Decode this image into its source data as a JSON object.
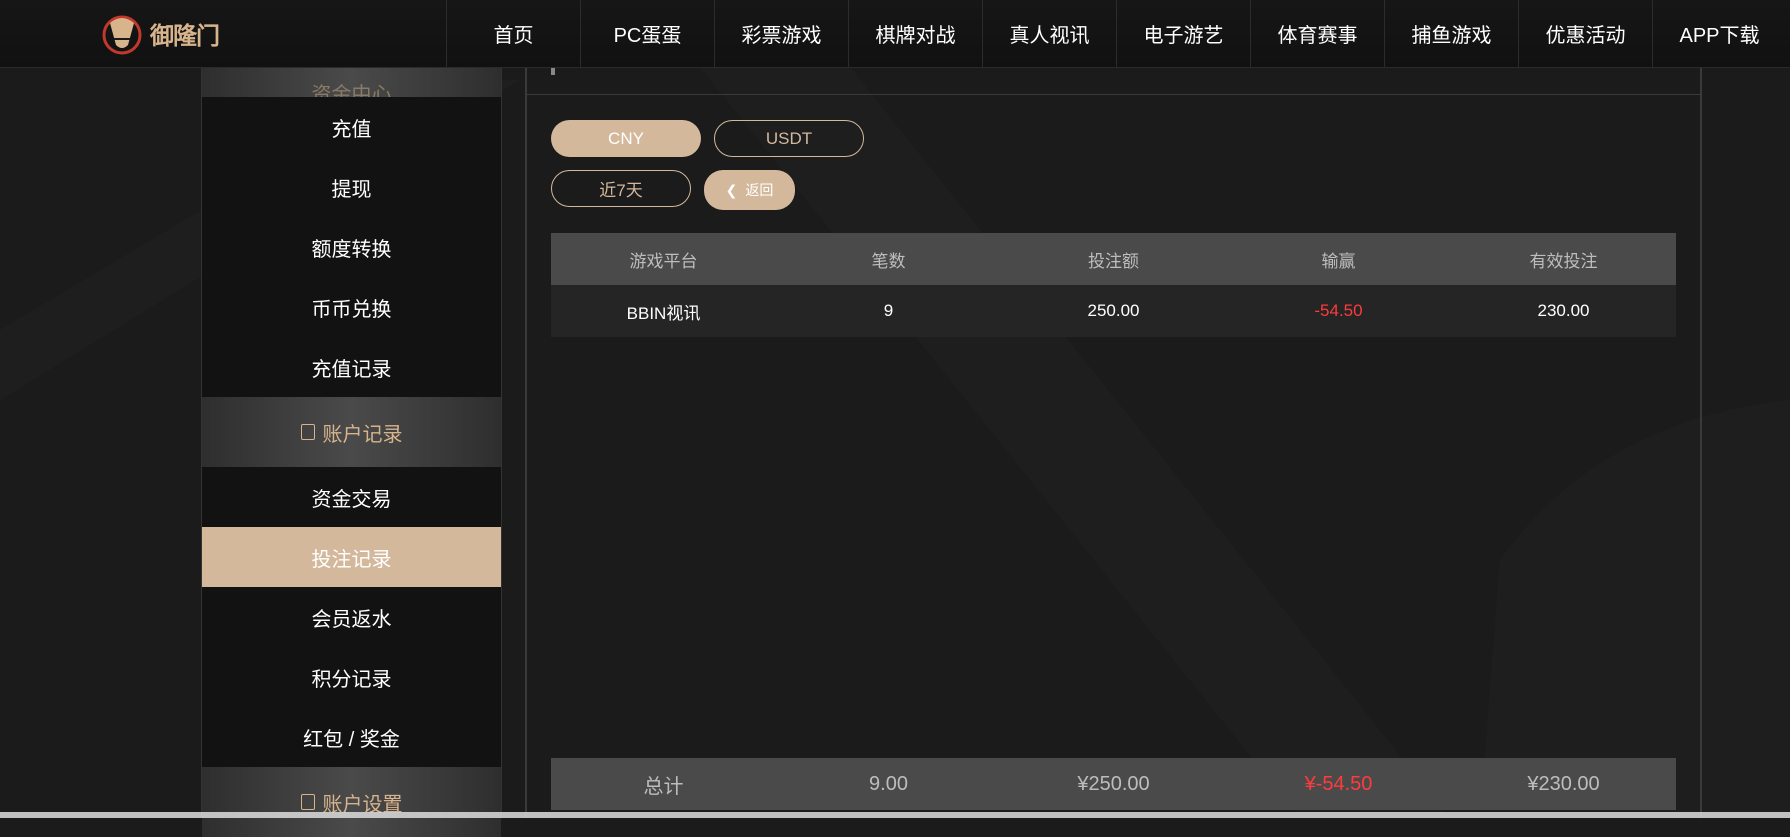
{
  "header": {
    "logo_text": "御隆门",
    "nav": [
      "首页",
      "PC蛋蛋",
      "彩票游戏",
      "棋牌对战",
      "真人视讯",
      "电子游艺",
      "体育赛事",
      "捕鱼游戏",
      "优惠活动",
      "APP下载"
    ]
  },
  "sidebar": {
    "top_section_label": "资金中心",
    "fund_items": [
      "充值",
      "提现",
      "额度转换",
      "币币兑换",
      "充值记录"
    ],
    "records_section_label": "账户记录",
    "record_items": [
      "资金交易",
      "投注记录",
      "会员返水",
      "积分记录",
      "红包 / 奖金"
    ],
    "active_item": "投注记录",
    "settings_section_label": "账户设置"
  },
  "main": {
    "currency_tabs": [
      "CNY",
      "USDT"
    ],
    "selected_currency": "CNY",
    "period_label": "近7天",
    "back_label": "返回",
    "table": {
      "headers": [
        "游戏平台",
        "笔数",
        "投注额",
        "输赢",
        "有效投注"
      ],
      "rows": [
        [
          "BBIN视讯",
          "9",
          "250.00",
          "-54.50",
          "230.00"
        ]
      ],
      "footer": [
        "总计",
        "9.00",
        "¥250.00",
        "¥-54.50",
        "¥230.00"
      ]
    }
  },
  "colors": {
    "accent": "#d4b89c",
    "negative": "#ff3b3b",
    "background": "#1b1b1b"
  }
}
